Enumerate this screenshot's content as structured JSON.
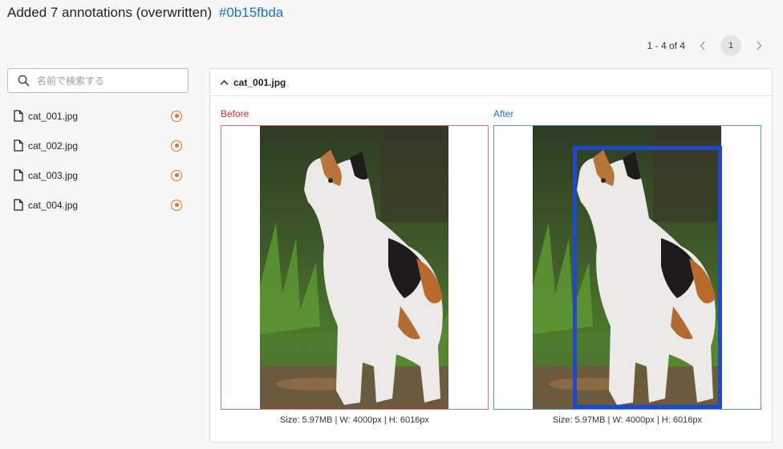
{
  "header": {
    "title": "Added 7 annotations (overwritten)",
    "hash": "#0b15fbda"
  },
  "pagination": {
    "range": "1 - 4 of 4",
    "current_page": "1"
  },
  "search": {
    "placeholder": "名前で検索する"
  },
  "files": [
    {
      "name": "cat_001.jpg"
    },
    {
      "name": "cat_002.jpg"
    },
    {
      "name": "cat_003.jpg"
    },
    {
      "name": "cat_004.jpg"
    }
  ],
  "panel": {
    "title": "cat_001.jpg",
    "before_label": "Before",
    "after_label": "After",
    "before_info": "Size: 5.97MB  | W: 4000px  | H: 6016px",
    "after_info": "Size: 5.97MB  | W: 4000px  | H: 6016px"
  },
  "colors": {
    "accent_link": "#1f6fcf",
    "before": "#d32f2f",
    "after": "#1f6fcf",
    "status": "#e8731e",
    "bbox": "#1e49c8"
  }
}
